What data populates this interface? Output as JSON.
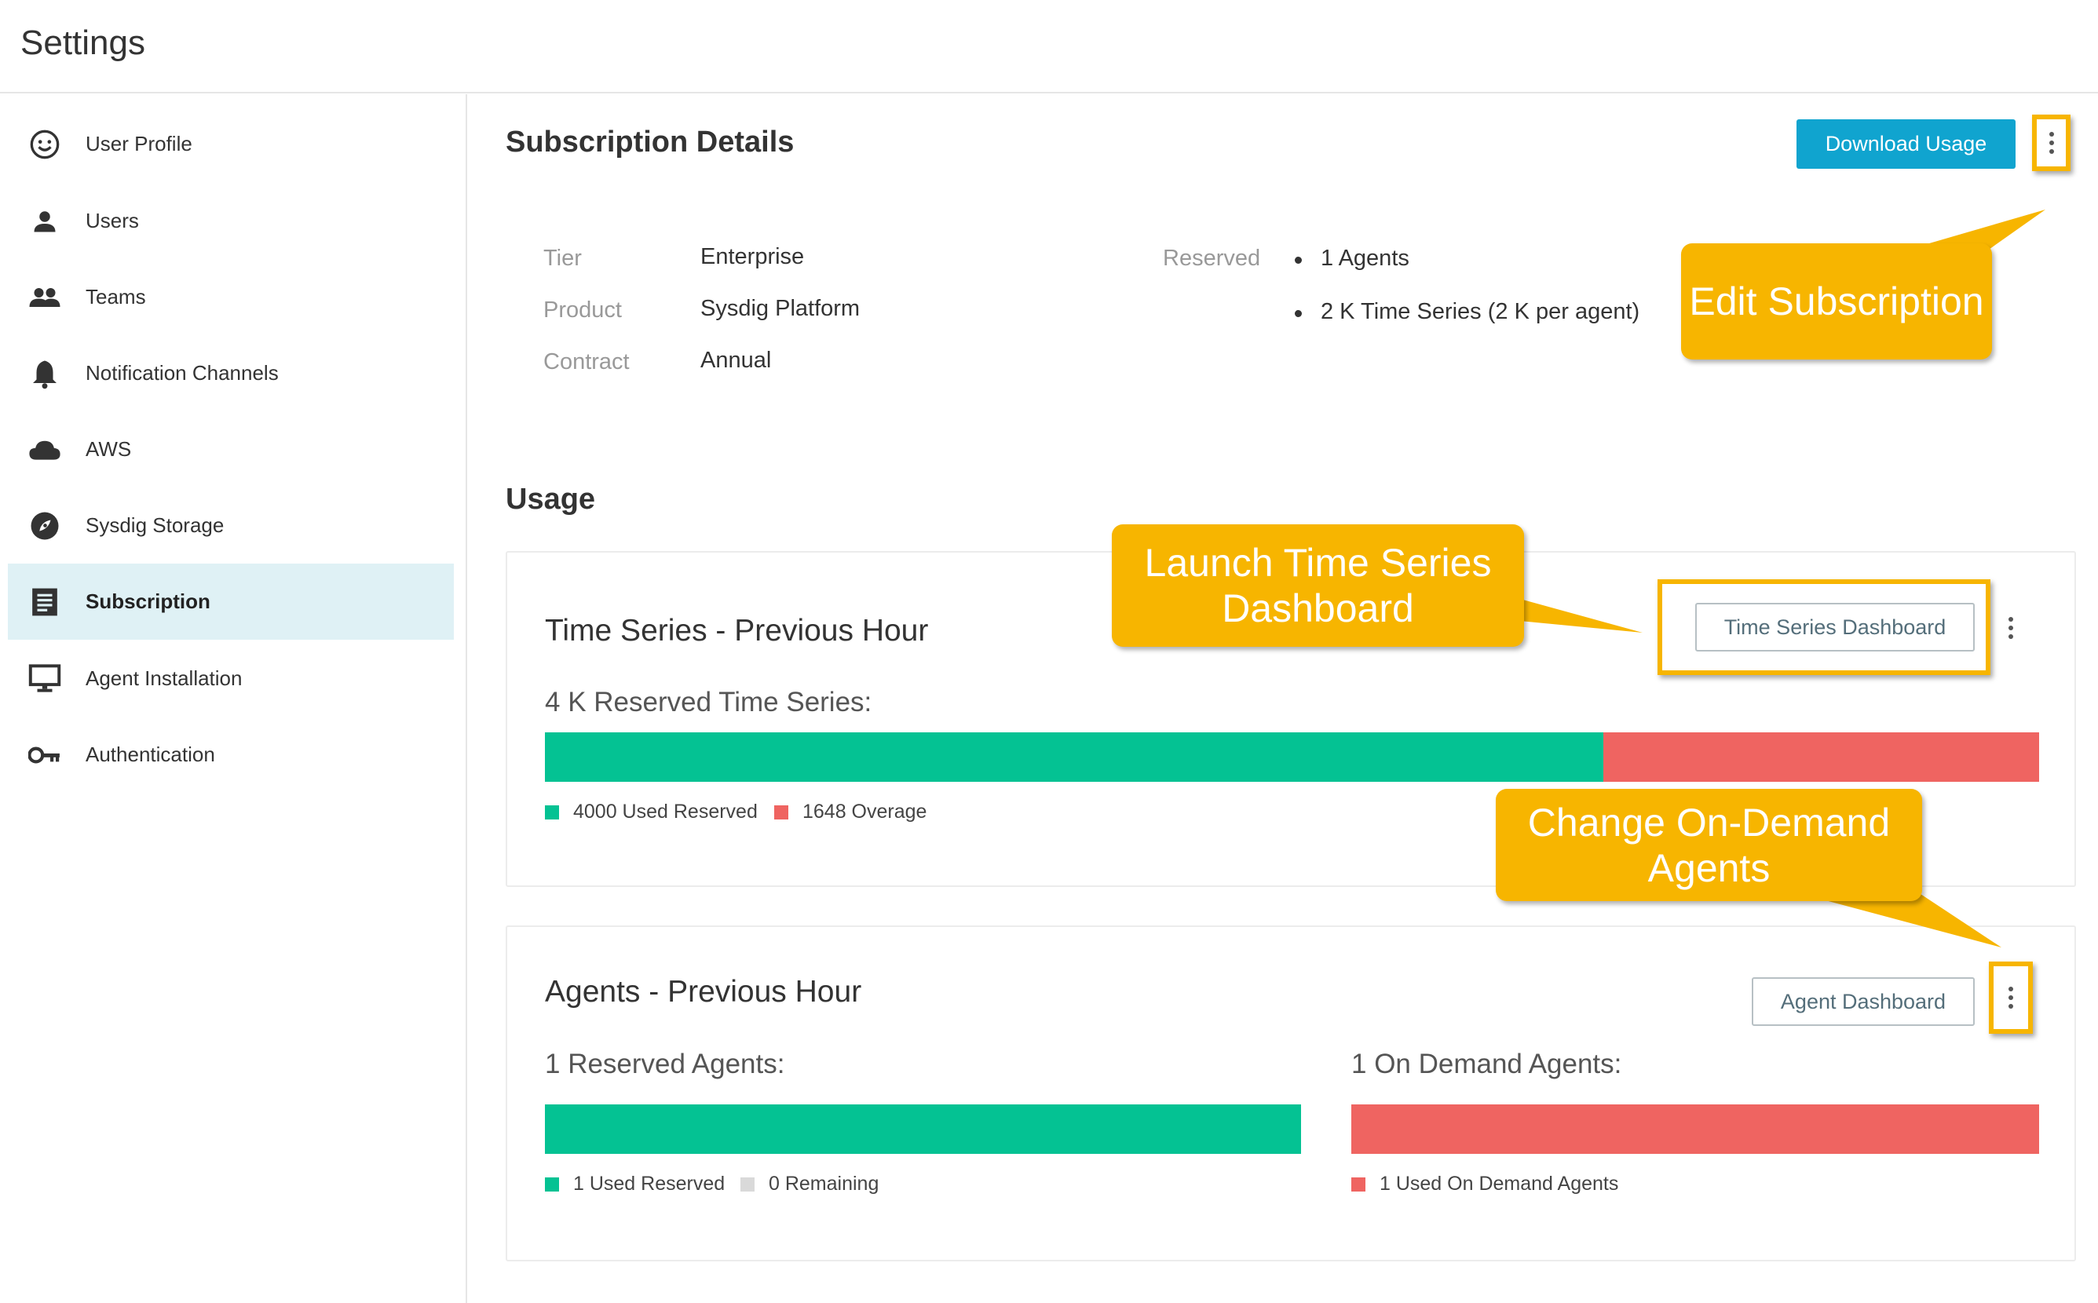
{
  "header": {
    "title": "Settings"
  },
  "sidebar": {
    "items": [
      {
        "label": "User Profile",
        "icon": "smiley-icon",
        "active": false
      },
      {
        "label": "Users",
        "icon": "user-icon",
        "active": false
      },
      {
        "label": "Teams",
        "icon": "group-icon",
        "active": false
      },
      {
        "label": "Notification Channels",
        "icon": "bell-icon",
        "active": false
      },
      {
        "label": "AWS",
        "icon": "cloud-icon",
        "active": false
      },
      {
        "label": "Sysdig Storage",
        "icon": "storage-icon",
        "active": false
      },
      {
        "label": "Subscription",
        "icon": "subscription-icon",
        "active": true
      },
      {
        "label": "Agent Installation",
        "icon": "monitor-icon",
        "active": false
      },
      {
        "label": "Authentication",
        "icon": "key-icon",
        "active": false
      }
    ]
  },
  "subscription": {
    "title": "Subscription Details",
    "download_button": "Download Usage",
    "details": [
      {
        "label": "Tier",
        "value": "Enterprise"
      },
      {
        "label": "Product",
        "value": "Sysdig Platform"
      },
      {
        "label": "Contract",
        "value": "Annual"
      }
    ],
    "reserved_label": "Reserved",
    "reserved_items": [
      "1 Agents",
      "2 K Time Series (2 K per agent)"
    ]
  },
  "usage": {
    "title": "Usage",
    "time_series": {
      "title": "Time Series - Previous Hour",
      "dashboard_button": "Time Series Dashboard",
      "reserved_label": "4 K Reserved Time Series:",
      "used_reserved": 4000,
      "overage": 1648,
      "legend_used": "4000 Used Reserved",
      "legend_overage": "1648 Overage"
    },
    "agents": {
      "title": "Agents - Previous Hour",
      "dashboard_button": "Agent Dashboard",
      "reserved_label": "1 Reserved Agents:",
      "on_demand_label": "1 On Demand Agents:",
      "used_reserved": 1,
      "remaining": 0,
      "used_on_demand": 1,
      "legend_used": "1 Used Reserved",
      "legend_remaining": "0 Remaining",
      "legend_on_demand": "1 Used On Demand Agents"
    }
  },
  "callouts": {
    "edit": "Edit Subscription",
    "launch": "Launch Time Series Dashboard",
    "change": "Change On-Demand Agents"
  },
  "colors": {
    "accent": "#10a4cf",
    "used": "#04c293",
    "overage": "#ef6461",
    "remaining": "#d9d9d9",
    "callout": "#f7b500",
    "active_nav": "#dff1f5"
  }
}
